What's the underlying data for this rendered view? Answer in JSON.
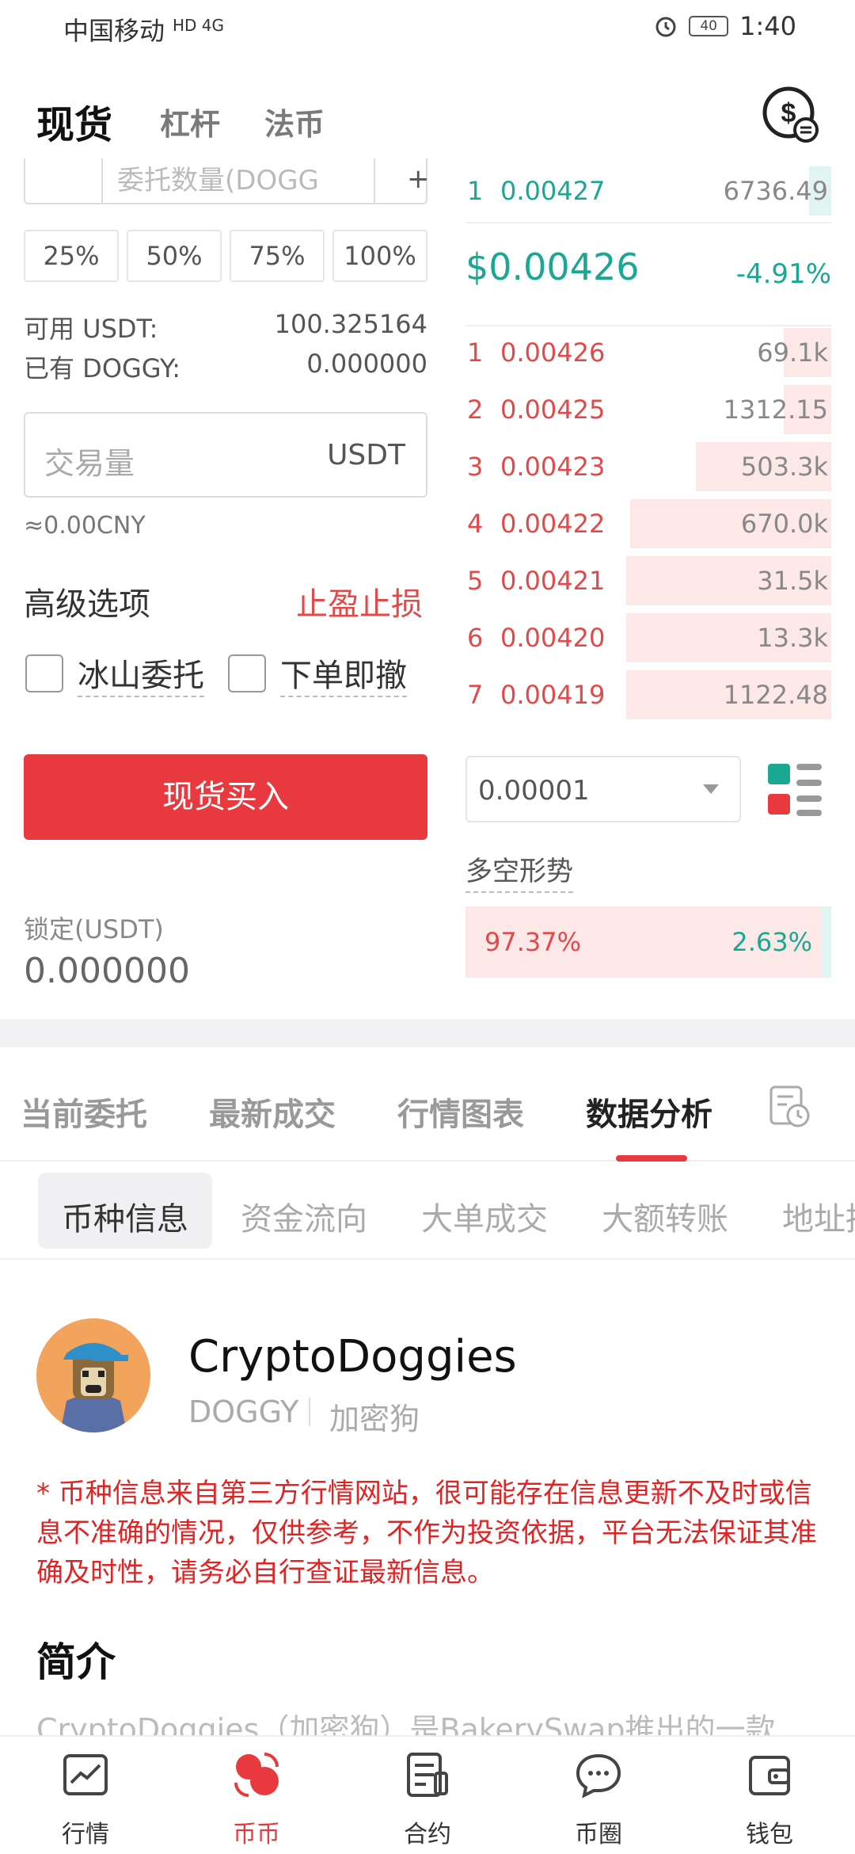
{
  "status_bar": {
    "carrier": "中国移动",
    "network": "HD 4G",
    "battery": "40",
    "time": "1:40"
  },
  "top_tabs": [
    "现货",
    "杠杆",
    "法币"
  ],
  "order_form": {
    "quantity_placeholder": "委托数量(DOGG",
    "quantity_step": "+",
    "percent_buttons": [
      "25%",
      "50%",
      "75%",
      "100%"
    ],
    "available_label": "可用 USDT:",
    "available_value": "100.325164",
    "held_label": "已有 DOGGY:",
    "held_value": "0.000000",
    "amount_placeholder": "交易量",
    "amount_unit": "USDT",
    "cny_estimate": "≈0.00CNY",
    "advanced_label": "高级选项",
    "stop_loss_label": "止盈止损",
    "iceberg_label": "冰山委托",
    "ioc_label": "下单即撤",
    "buy_button": "现货买入",
    "locked_label": "锁定(USDT)",
    "locked_value": "0.000000"
  },
  "order_book": {
    "buy_top": {
      "index": "1",
      "price": "0.00427",
      "qty": "6736.49",
      "depth": 0.06
    },
    "last_price": "$0.00426",
    "change": "-4.91%",
    "sells": [
      {
        "index": "1",
        "price": "0.00426",
        "qty": "69.1k",
        "depth": 0.13
      },
      {
        "index": "2",
        "price": "0.00425",
        "qty": "1312.15",
        "depth": 0.13
      },
      {
        "index": "3",
        "price": "0.00423",
        "qty": "503.3k",
        "depth": 0.37
      },
      {
        "index": "4",
        "price": "0.00422",
        "qty": "670.0k",
        "depth": 0.55
      },
      {
        "index": "5",
        "price": "0.00421",
        "qty": "31.5k",
        "depth": 0.56
      },
      {
        "index": "6",
        "price": "0.00420",
        "qty": "13.3k",
        "depth": 0.56
      },
      {
        "index": "7",
        "price": "0.00419",
        "qty": "1122.48",
        "depth": 0.56
      }
    ],
    "precision": "0.00001"
  },
  "long_short": {
    "title": "多空形势",
    "short_pct": "97.37%",
    "long_pct": "2.63%",
    "long_share": 0.026
  },
  "main_tabs": [
    "当前委托",
    "最新成交",
    "行情图表",
    "数据分析"
  ],
  "sub_tabs": [
    "币种信息",
    "资金流向",
    "大单成交",
    "大额转账",
    "地址持"
  ],
  "coin": {
    "name": "CryptoDoggies",
    "symbol": "DOGGY",
    "cn_name": "加密狗"
  },
  "disclaimer": "* 币种信息来自第三方行情网站，很可能存在信息更新不及时或信息不准确的情况，仅供参考，不作为投资依据，平台无法保证其准确及时性，请务必自行查证最新信息。",
  "intro_title": "简介",
  "intro_text": "CryptoDoggies（加密狗）是BakerySwap推出的一款",
  "bottom_nav": [
    "行情",
    "币币",
    "合约",
    "币圈",
    "钱包"
  ],
  "colors": {
    "red": "#e8393e",
    "green": "#1aa892"
  }
}
